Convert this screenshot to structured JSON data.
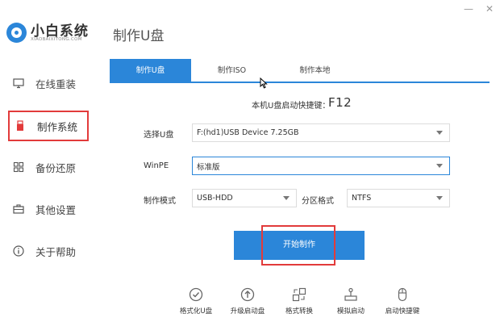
{
  "app": {
    "logo_title": "小白系统",
    "logo_subtitle": "XIAOBAIXITONG.COM",
    "page_title": "制作U盘"
  },
  "window": {
    "minimize": "—",
    "close": "✕"
  },
  "sidebar": {
    "items": [
      {
        "label": "在线重装",
        "icon": "monitor-icon"
      },
      {
        "label": "制作系统",
        "icon": "usb-drive-icon",
        "active": true
      },
      {
        "label": "备份还原",
        "icon": "grid-icon"
      },
      {
        "label": "其他设置",
        "icon": "briefcase-icon"
      },
      {
        "label": "关于帮助",
        "icon": "info-icon"
      }
    ]
  },
  "tabs": [
    {
      "label": "制作U盘",
      "active": true
    },
    {
      "label": "制作ISO"
    },
    {
      "label": "制作本地"
    }
  ],
  "hotkey": {
    "label": "本机U盘启动快捷键：",
    "value": "F12"
  },
  "form": {
    "select_usb": {
      "label": "选择U盘",
      "value": "F:(hd1)USB Device 7.25GB"
    },
    "winpe": {
      "label": "WinPE",
      "value": "标准版"
    },
    "mode": {
      "label": "制作模式",
      "value": "USB-HDD"
    },
    "partition": {
      "label": "分区格式",
      "value": "NTFS"
    }
  },
  "start_button": {
    "label": "开始制作"
  },
  "tools": [
    {
      "label": "格式化U盘",
      "icon": "check-circle-icon"
    },
    {
      "label": "升级启动盘",
      "icon": "upload-circle-icon"
    },
    {
      "label": "格式转换",
      "icon": "convert-icon"
    },
    {
      "label": "模拟启动",
      "icon": "joystick-icon"
    },
    {
      "label": "启动快捷键",
      "icon": "mouse-icon"
    }
  ],
  "colors": {
    "accent": "#2b86d9",
    "highlight": "#e23b3b"
  }
}
